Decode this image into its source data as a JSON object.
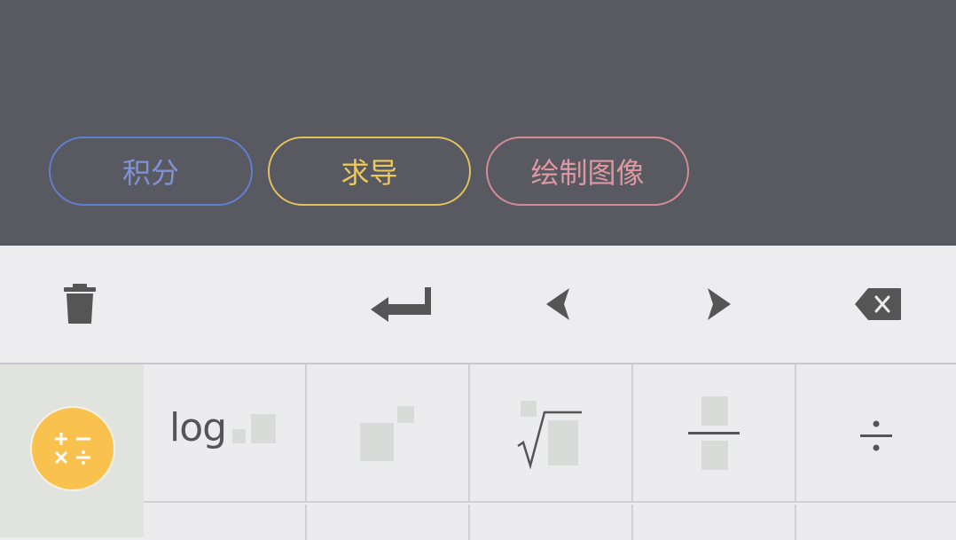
{
  "actions": {
    "integral": "积分",
    "derivative": "求导",
    "graph": "绘制图像"
  },
  "colors": {
    "background_top": "#595962",
    "integral": "#5f7fd0",
    "derivative": "#e2c35a",
    "graph": "#d48c94",
    "operator_button": "#f9c24e"
  },
  "toolbar": {
    "icons": [
      "trash-icon",
      "enter-icon",
      "cursor-left-icon",
      "cursor-right-icon",
      "backspace-icon"
    ]
  },
  "keypad": {
    "log_label": "log",
    "operators_icon": "plus-minus-times-divide-icon",
    "keys": [
      "log-key",
      "power-key",
      "nth-root-key",
      "fraction-key",
      "divide-key"
    ]
  }
}
